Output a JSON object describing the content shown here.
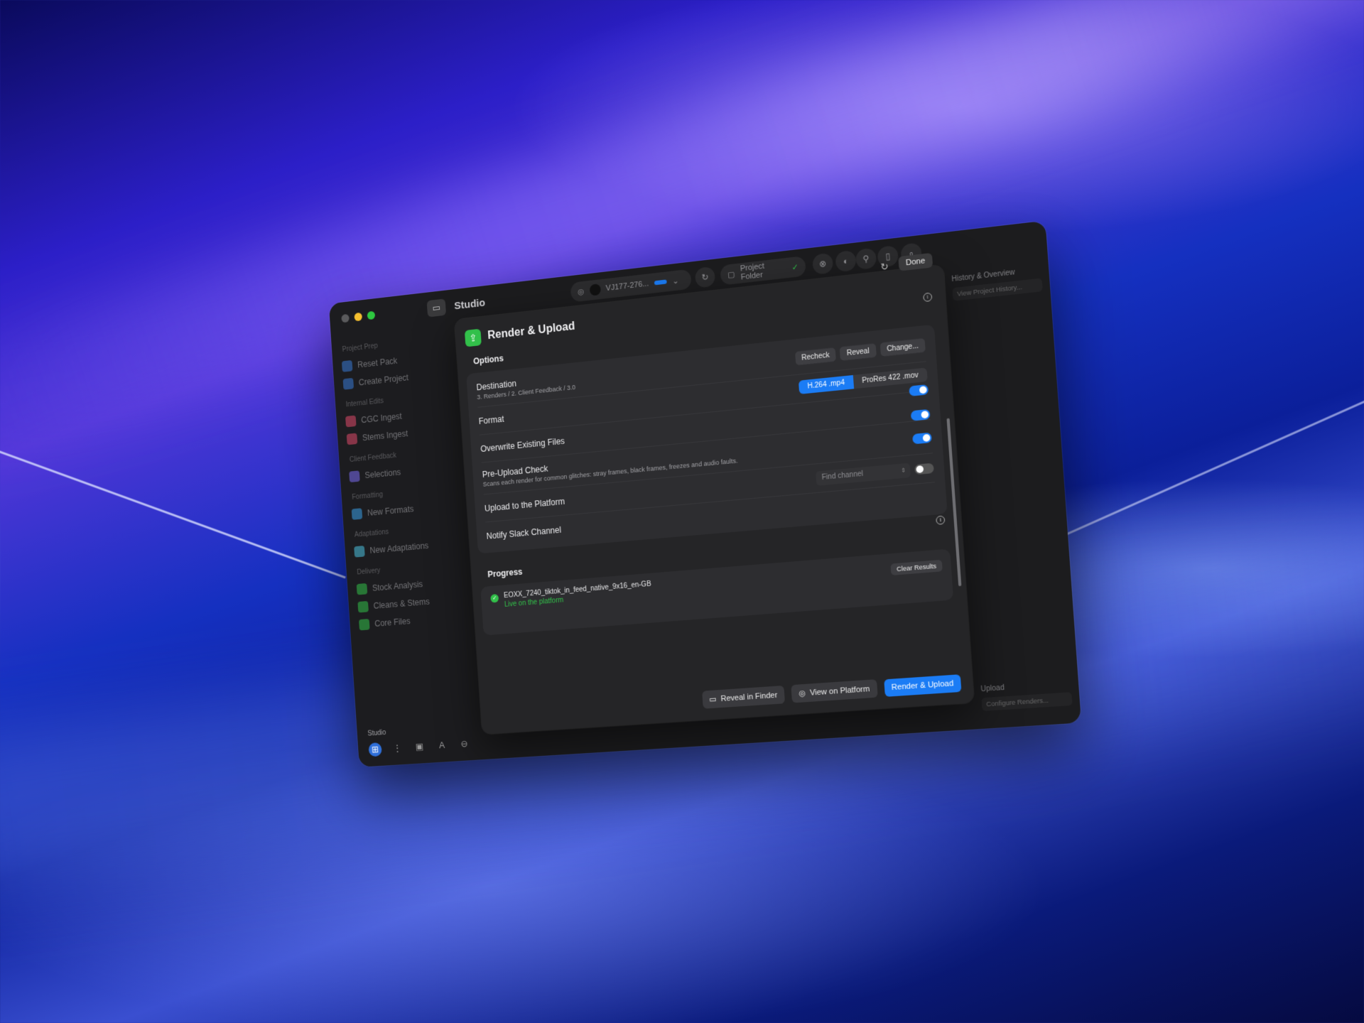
{
  "window": {
    "title": "Studio"
  },
  "sidebar": {
    "sections": [
      {
        "label": "Project Prep",
        "items": [
          {
            "label": "Reset Pack",
            "color": "#3a7bd5"
          },
          {
            "label": "Create Project",
            "color": "#3a7bd5"
          }
        ]
      },
      {
        "label": "Internal Edits",
        "items": [
          {
            "label": "CGC Ingest",
            "color": "#e04b6a"
          },
          {
            "label": "Stems Ingest",
            "color": "#e04b6a"
          }
        ]
      },
      {
        "label": "Client Feedback",
        "items": [
          {
            "label": "Selections",
            "color": "#7a6bf0"
          }
        ]
      },
      {
        "label": "Formatting",
        "items": [
          {
            "label": "New Formats",
            "color": "#3aa0e8"
          }
        ]
      },
      {
        "label": "Adaptations",
        "items": [
          {
            "label": "New Adaptations",
            "color": "#4cc2e0"
          }
        ]
      },
      {
        "label": "Delivery",
        "items": [
          {
            "label": "Stock Analysis",
            "color": "#32c04a"
          },
          {
            "label": "Cleans & Stems",
            "color": "#32c04a"
          },
          {
            "label": "Core Files",
            "color": "#32c04a"
          }
        ]
      }
    ],
    "footer_label": "Studio"
  },
  "toolbar": {
    "project_code": "VJ177-276...",
    "project_folder_label": "Project Folder"
  },
  "right_pane": {
    "history_title": "History & Overview",
    "history_field": "View Project History...",
    "upload_title": "Upload",
    "configure_field": "Configure Renders..."
  },
  "sheet": {
    "title": "Render & Upload",
    "done_label": "Done",
    "options_label": "Options",
    "destination": {
      "title": "Destination",
      "path": "3. Renders / 2. Client Feedback / 3.0",
      "recheck_label": "Recheck",
      "reveal_label": "Reveal",
      "change_label": "Change..."
    },
    "format": {
      "title": "Format",
      "options": [
        "H.264 .mp4",
        "ProRes 422 .mov"
      ],
      "selected": "H.264 .mp4"
    },
    "overwrite": {
      "title": "Overwrite Existing Files",
      "enabled": true
    },
    "pre_upload": {
      "title": "Pre-Upload Check",
      "description": "Scans each render for common glitches: stray frames, black frames, freezes and audio faults.",
      "enabled": true
    },
    "upload_platform": {
      "title": "Upload to the Platform",
      "enabled": true
    },
    "slack": {
      "title": "Notify Slack Channel",
      "placeholder": "Find channel",
      "enabled": false
    },
    "progress_label": "Progress",
    "progress_item": {
      "file": "EOXX_7240_tiktok_in_feed_native_9x16_en-GB",
      "status": "Live on the platform"
    },
    "clear_results_label": "Clear Results",
    "footer": {
      "reveal_finder_label": "Reveal in Finder",
      "view_platform_label": "View on Platform",
      "render_upload_label": "Render & Upload"
    }
  }
}
